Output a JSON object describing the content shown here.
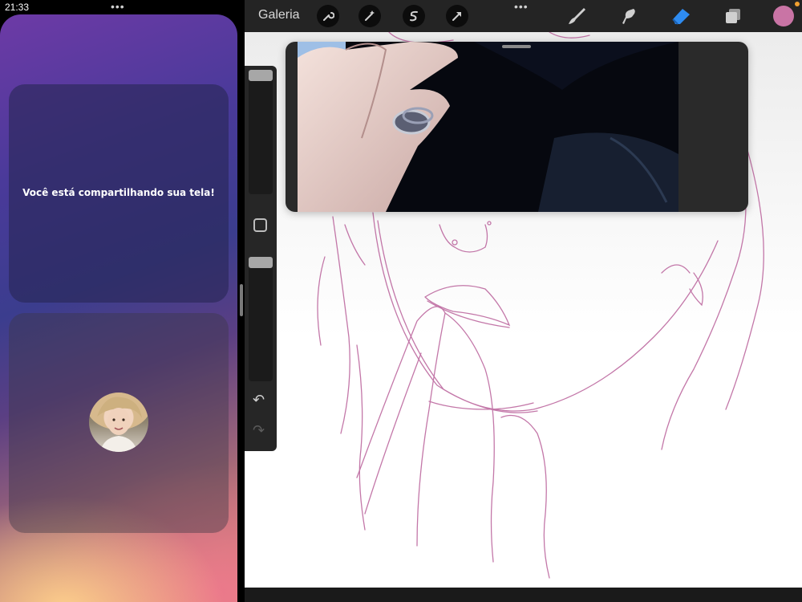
{
  "status_bar": {
    "time": "21:33"
  },
  "call": {
    "share_message": "Você está compartilhando sua tela!",
    "participant_avatar_icon": "user-avatar"
  },
  "procreate": {
    "gallery_label": "Galeria",
    "tools": [
      "wrench-icon",
      "magic-wand-icon",
      "selection-icon",
      "transform-arrow-icon"
    ],
    "painting_tools": [
      "brush-icon",
      "smudge-icon",
      "eraser-icon",
      "layers-icon"
    ],
    "active_tool": "eraser",
    "current_color": "#c974a5",
    "active_tool_color": "#2e8bf0"
  }
}
